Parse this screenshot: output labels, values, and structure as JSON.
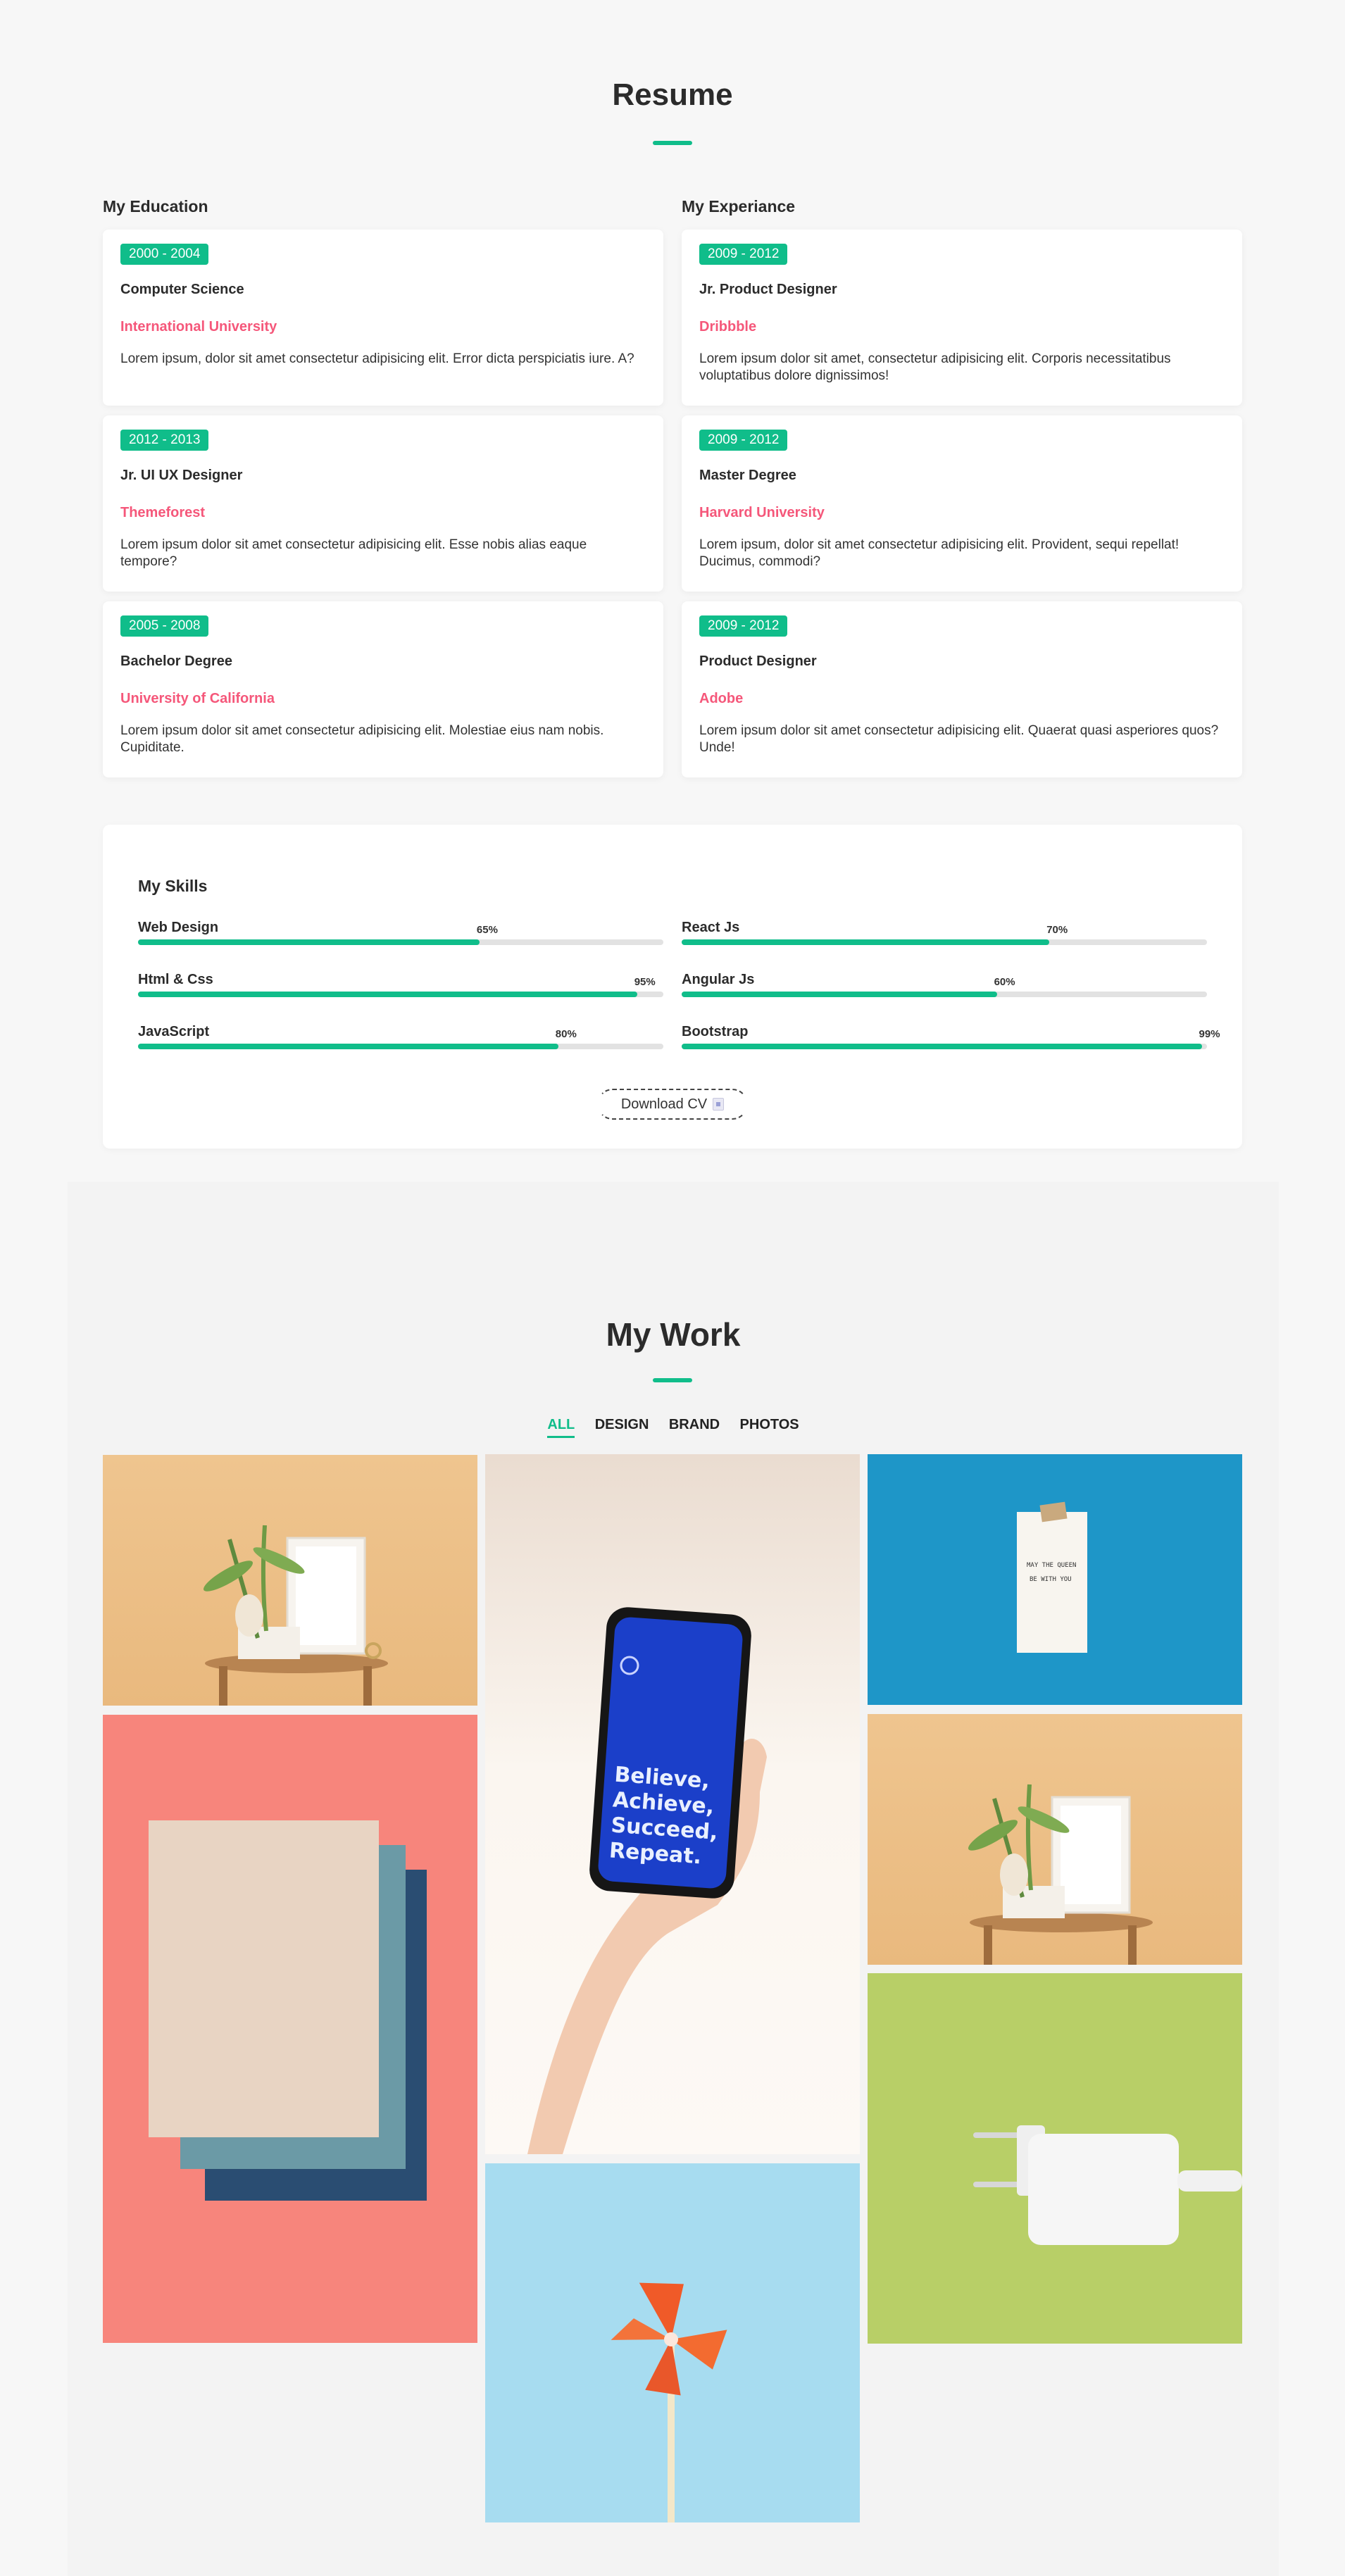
{
  "resume": {
    "title": "Resume",
    "education": {
      "heading": "My Education",
      "items": [
        {
          "years": "2000 - 2004",
          "title": "Computer Science",
          "org": "International University",
          "text": "Lorem ipsum, dolor sit amet consectetur adipisicing elit. Error dicta perspiciatis iure. A?"
        },
        {
          "years": "2012 - 2013",
          "title": "Jr. UI UX Designer",
          "org": "Themeforest",
          "text": "Lorem ipsum dolor sit amet consectetur adipisicing elit. Esse nobis alias eaque tempore?"
        },
        {
          "years": "2005 - 2008",
          "title": "Bachelor Degree",
          "org": "University of California",
          "text": "Lorem ipsum dolor sit amet consectetur adipisicing elit. Molestiae eius nam nobis. Cupiditate."
        }
      ]
    },
    "experience": {
      "heading": "My Experiance",
      "items": [
        {
          "years": "2009 - 2012",
          "title": "Jr. Product Designer",
          "org": "Dribbble",
          "text": "Lorem ipsum dolor sit amet, consectetur adipisicing elit. Corporis necessitatibus voluptatibus dolore dignissimos!"
        },
        {
          "years": "2009 - 2012",
          "title": "Master Degree",
          "org": "Harvard University",
          "text": "Lorem ipsum, dolor sit amet consectetur adipisicing elit. Provident, sequi repellat! Ducimus, commodi?"
        },
        {
          "years": "2009 - 2012",
          "title": "Product Designer",
          "org": "Adobe",
          "text": "Lorem ipsum dolor sit amet consectetur adipisicing elit. Quaerat quasi asperiores quos? Unde!"
        }
      ]
    },
    "skills": {
      "heading": "My Skills",
      "items": [
        {
          "name": "Web Design",
          "percent_label": "65%",
          "value": 65
        },
        {
          "name": "React Js",
          "percent_label": "70%",
          "value": 70
        },
        {
          "name": "Html & Css",
          "percent_label": "95%",
          "value": 95
        },
        {
          "name": "Angular Js",
          "percent_label": "60%",
          "value": 60
        },
        {
          "name": "JavaScript",
          "percent_label": "80%",
          "value": 80
        },
        {
          "name": "Bootstrap",
          "percent_label": "99%",
          "value": 99
        }
      ],
      "download_label": "Download CV"
    }
  },
  "work": {
    "title": "My Work",
    "filters": [
      "ALL",
      "DESIGN",
      "BRAND",
      "PHOTOS"
    ],
    "active_filter": "ALL",
    "phone_text": "Believe,\nAchieve,\nSucceed,\nRepeat.",
    "note_text": "MAY THE QUEEN\nBE WITH YOU",
    "colors": {
      "accent": "#10bd8a",
      "org": "#f5577a"
    }
  }
}
